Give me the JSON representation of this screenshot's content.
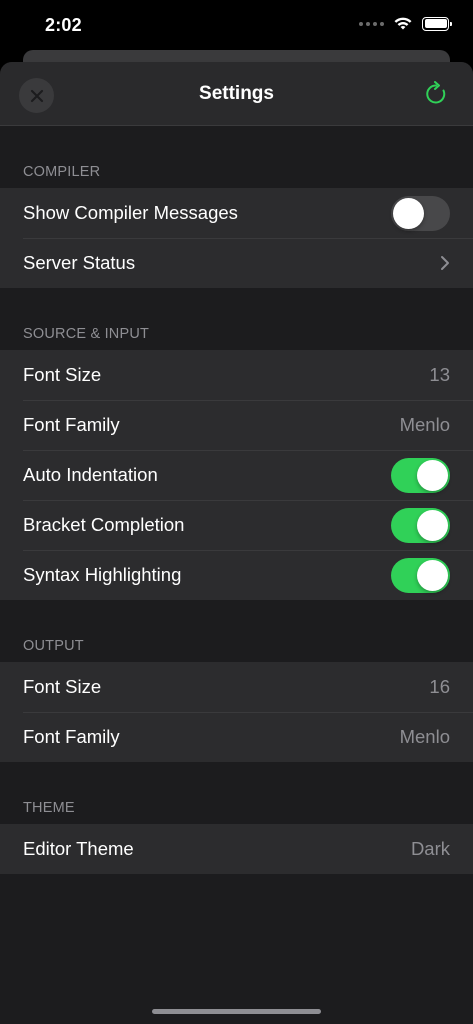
{
  "status_bar": {
    "time": "2:02"
  },
  "nav": {
    "title": "Settings"
  },
  "colors": {
    "accent": "#30d158",
    "background": "#1c1c1e",
    "cell": "#2c2c2e",
    "secondary_text": "#8e8e93"
  },
  "sections": {
    "compiler": {
      "header": "COMPILER",
      "show_messages": {
        "label": "Show Compiler Messages",
        "on": false
      },
      "server_status": {
        "label": "Server Status"
      }
    },
    "source": {
      "header": "SOURCE & INPUT",
      "font_size": {
        "label": "Font Size",
        "value": "13"
      },
      "font_family": {
        "label": "Font Family",
        "value": "Menlo"
      },
      "auto_indent": {
        "label": "Auto Indentation",
        "on": true
      },
      "bracket": {
        "label": "Bracket Completion",
        "on": true
      },
      "syntax": {
        "label": "Syntax Highlighting",
        "on": true
      }
    },
    "output": {
      "header": "OUTPUT",
      "font_size": {
        "label": "Font Size",
        "value": "16"
      },
      "font_family": {
        "label": "Font Family",
        "value": "Menlo"
      }
    },
    "theme": {
      "header": "THEME",
      "editor_theme": {
        "label": "Editor Theme",
        "value": "Dark"
      }
    }
  }
}
